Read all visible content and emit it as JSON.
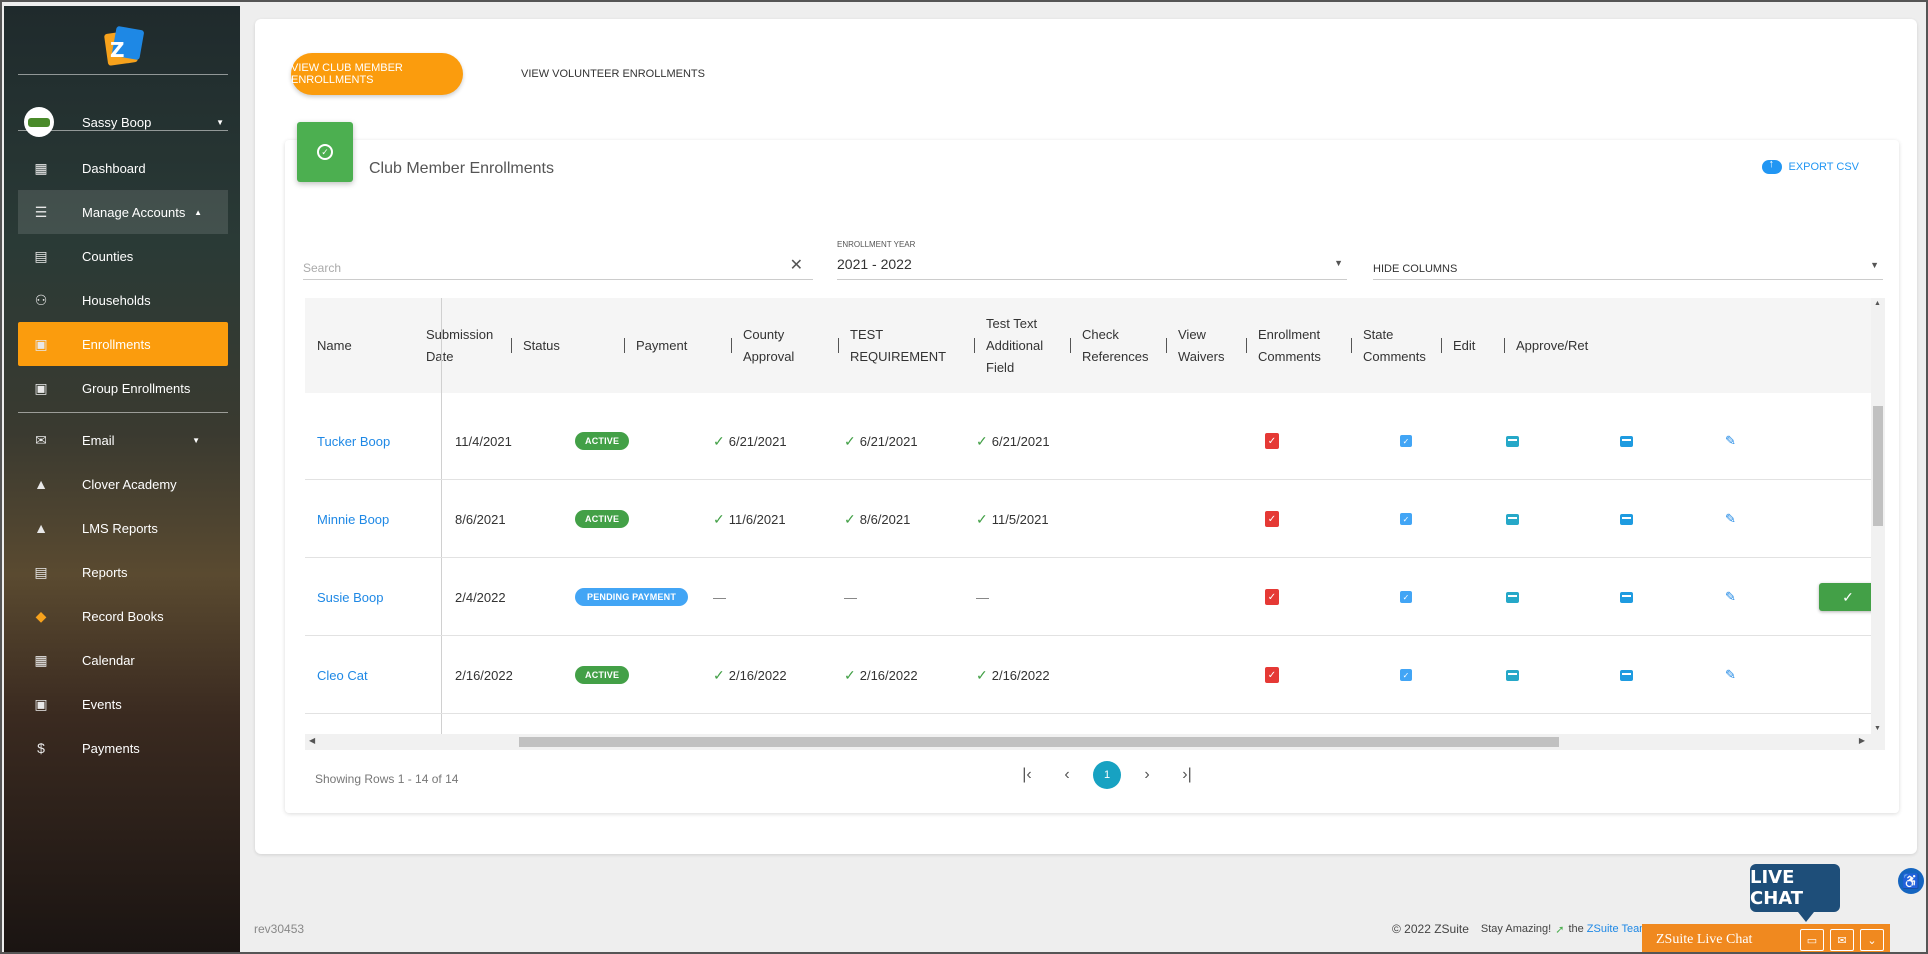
{
  "sidebar": {
    "user_name": "Sassy Boop",
    "items": [
      {
        "label": "Dashboard",
        "icon": "dashboard-icon"
      },
      {
        "label": "Manage Accounts",
        "icon": "list-icon"
      },
      {
        "label": "Counties",
        "icon": "document-icon"
      },
      {
        "label": "Households",
        "icon": "people-icon"
      },
      {
        "label": "Enrollments",
        "icon": "enrollment-icon"
      },
      {
        "label": "Group Enrollments",
        "icon": "group-enrollment-icon"
      },
      {
        "label": "Email",
        "icon": "mail-icon"
      },
      {
        "label": "Clover Academy",
        "icon": "school-icon"
      },
      {
        "label": "LMS Reports",
        "icon": "school-icon"
      },
      {
        "label": "Reports",
        "icon": "clipboard-icon"
      },
      {
        "label": "Record Books",
        "icon": "record-books-icon"
      },
      {
        "label": "Calendar",
        "icon": "calendar-icon"
      },
      {
        "label": "Events",
        "icon": "event-icon"
      },
      {
        "label": "Payments",
        "icon": "dollar-icon"
      }
    ]
  },
  "tabs": {
    "club_member": "VIEW CLUB MEMBER ENROLLMENTS",
    "volunteer": "VIEW VOLUNTEER ENROLLMENTS"
  },
  "panel": {
    "title": "Club Member Enrollments",
    "export": "EXPORT CSV"
  },
  "filters": {
    "search_placeholder": "Search",
    "year_label": "ENROLLMENT YEAR",
    "year_value": "2021 - 2022",
    "hide_columns": "HIDE COLUMNS"
  },
  "table": {
    "headers": {
      "name": "Name",
      "submission1": "Submission",
      "submission2": "Date",
      "status": "Status",
      "payment": "Payment",
      "county1": "County",
      "county2": "Approval",
      "test1": "TEST",
      "test2": "REQUIREMENT",
      "testtext1": "Test Text",
      "testtext2": "Additional",
      "testtext3": "Field",
      "check1": "Check",
      "check2": "References",
      "waivers1": "View",
      "waivers2": "Waivers",
      "enroll1": "Enrollment",
      "enroll2": "Comments",
      "state1": "State",
      "state2": "Comments",
      "edit": "Edit",
      "approve": "Approve/Ret"
    },
    "rows": [
      {
        "name": "Tucker Boop",
        "date": "11/4/2021",
        "status": "ACTIVE",
        "payment": "6/21/2021",
        "county": "6/21/2021",
        "test": "6/21/2021"
      },
      {
        "name": "Minnie Boop",
        "date": "8/6/2021",
        "status": "ACTIVE",
        "payment": "11/6/2021",
        "county": "8/6/2021",
        "test": "11/5/2021"
      },
      {
        "name": "Susie Boop",
        "date": "2/4/2022",
        "status": "PENDING PAYMENT",
        "payment": "—",
        "county": "—",
        "test": "—"
      },
      {
        "name": "Cleo Cat",
        "date": "2/16/2022",
        "status": "ACTIVE",
        "payment": "2/16/2022",
        "county": "2/16/2022",
        "test": "2/16/2022"
      }
    ]
  },
  "pagination": {
    "showing": "Showing Rows 1 - 14 of 14",
    "current_page": "1"
  },
  "footer": {
    "rev": "rev30453",
    "copyright": "© 2022 ZSuite",
    "stay": "Stay Amazing!",
    "the": "the",
    "team": "ZSuite Team"
  },
  "live_chat": {
    "bubble": "LIVE CHAT",
    "bar": "ZSuite Live Chat"
  },
  "colors": {
    "accent": "#fb9c0d",
    "active_badge": "#43a047",
    "pending_badge": "#42a5f5",
    "link": "#1e88e5"
  }
}
